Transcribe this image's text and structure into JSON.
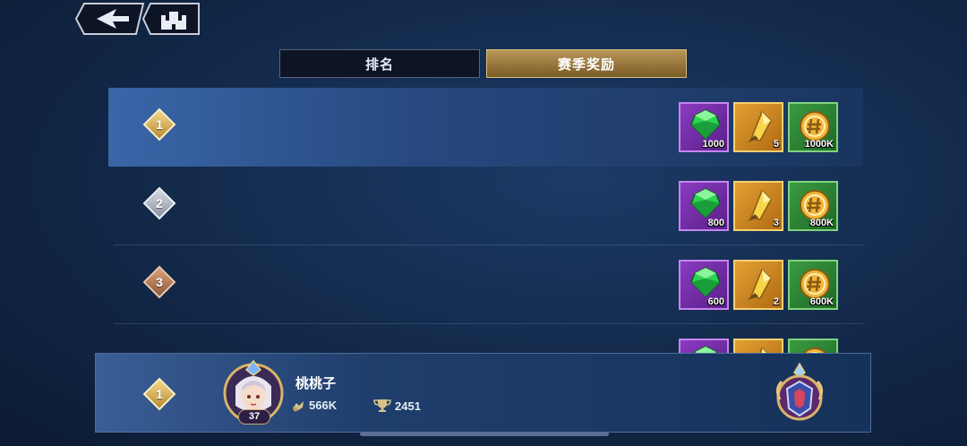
{
  "tabs": {
    "rank_label": "排名",
    "season_rewards_label": "赛季奖励",
    "active": "season_rewards"
  },
  "reward_rows": [
    {
      "rank": "1",
      "tier": "gold",
      "highlighted": true,
      "rewards": [
        {
          "type": "gem-icon",
          "frame": "purple",
          "qty": "1000"
        },
        {
          "type": "crystal-shard-icon",
          "frame": "orange",
          "qty": "5"
        },
        {
          "type": "gold-coin-icon",
          "frame": "green",
          "qty": "1000K"
        }
      ]
    },
    {
      "rank": "2",
      "tier": "silver",
      "highlighted": false,
      "rewards": [
        {
          "type": "gem-icon",
          "frame": "purple",
          "qty": "800"
        },
        {
          "type": "crystal-shard-icon",
          "frame": "orange",
          "qty": "3"
        },
        {
          "type": "gold-coin-icon",
          "frame": "green",
          "qty": "800K"
        }
      ]
    },
    {
      "rank": "3",
      "tier": "bronze",
      "highlighted": false,
      "rewards": [
        {
          "type": "gem-icon",
          "frame": "purple",
          "qty": "600"
        },
        {
          "type": "crystal-shard-icon",
          "frame": "orange",
          "qty": "2"
        },
        {
          "type": "gold-coin-icon",
          "frame": "green",
          "qty": "600K"
        }
      ]
    },
    {
      "rank": "",
      "tier": "gold",
      "highlighted": false,
      "partial": true,
      "rewards": [
        {
          "type": "gem-icon",
          "frame": "purple",
          "qty": ""
        },
        {
          "type": "crystal-shard-icon",
          "frame": "orange",
          "qty": ""
        },
        {
          "type": "gold-coin-icon",
          "frame": "green",
          "qty": ""
        }
      ]
    }
  ],
  "my_rank": {
    "rank": "1",
    "player_name": "桃桃子",
    "level": "37",
    "power": "566K",
    "trophies": "2451"
  }
}
